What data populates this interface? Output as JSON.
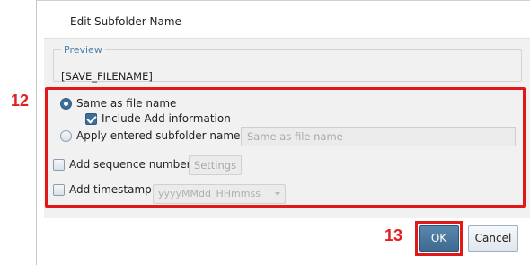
{
  "callouts": {
    "region_12": "12",
    "ok_13": "13"
  },
  "dialog": {
    "title": "Edit Subfolder Name",
    "preview": {
      "legend": "Preview",
      "value": "[SAVE_FILENAME]"
    },
    "options": {
      "same_as_file_name": {
        "label": "Same as file name",
        "checked": true
      },
      "include_add_info": {
        "label": "Include Add information",
        "checked": true
      },
      "apply_entered": {
        "label": "Apply entered subfolder name",
        "checked": false,
        "input_placeholder": "Same as file name"
      },
      "add_sequence": {
        "label": "Add sequence number",
        "checked": false,
        "settings_label": "Settings"
      },
      "add_timestamp": {
        "label": "Add timestamp",
        "checked": false,
        "format_value": "yyyyMMdd_HHmmss"
      }
    },
    "buttons": {
      "ok": "OK",
      "cancel": "Cancel"
    }
  },
  "colors": {
    "accent": "#3f6a90",
    "callout": "#e01818"
  }
}
